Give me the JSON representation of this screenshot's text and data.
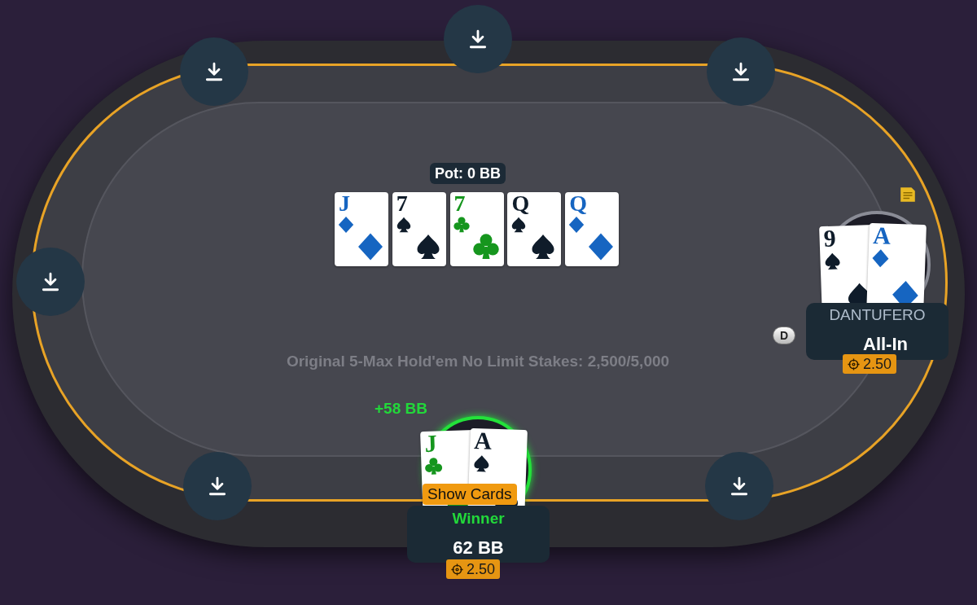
{
  "table": {
    "pot": "Pot: 0 BB",
    "game_info": "Original 5-Max Hold'em No Limit Stakes: 2,500/5,000",
    "board": [
      {
        "rank": "J",
        "kind": "diamonds"
      },
      {
        "rank": "7",
        "kind": "spades"
      },
      {
        "rank": "7",
        "kind": "clubs"
      },
      {
        "rank": "Q",
        "kind": "spades"
      },
      {
        "rank": "Q",
        "kind": "diamonds"
      }
    ]
  },
  "seats": [
    {
      "kind": "empty"
    },
    {
      "kind": "empty"
    },
    {
      "kind": "empty"
    },
    {
      "kind": "empty"
    },
    {
      "kind": "player",
      "name": "DANTUFERO",
      "status": "All-In",
      "bet": "2.50",
      "dealer_button": "D",
      "winner": false,
      "cards": [
        {
          "rank": "9",
          "kind": "spades"
        },
        {
          "rank": "A",
          "kind": "diamonds"
        }
      ]
    },
    {
      "kind": "empty"
    },
    {
      "kind": "player",
      "winnings": "+58 BB",
      "show_cards_button": "Show Cards",
      "result": "Winner",
      "status": "62 BB",
      "bet": "2.50",
      "winner": true,
      "cards": [
        {
          "rank": "J",
          "kind": "clubs"
        },
        {
          "rank": "A",
          "kind": "spades"
        }
      ]
    },
    {
      "kind": "empty"
    }
  ]
}
